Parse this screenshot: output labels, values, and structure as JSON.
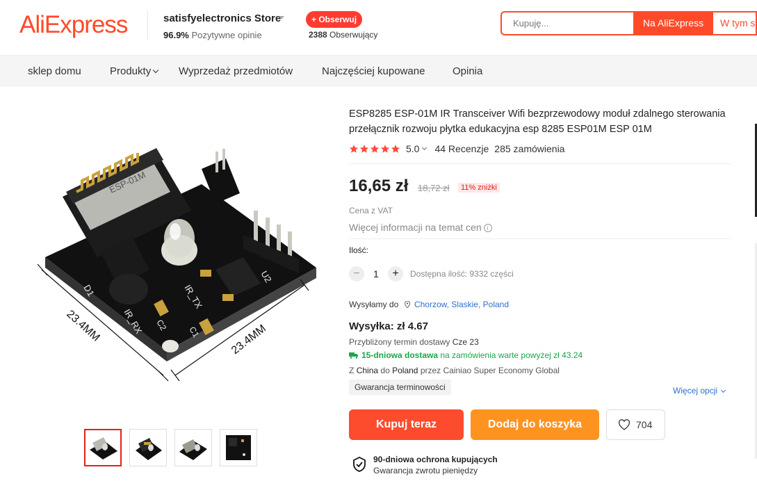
{
  "header": {
    "logo": "AliExpress",
    "store_name": "satisfyelectronics Store",
    "rating_value": "96.9%",
    "rating_label": "Pozytywne opinie",
    "follow_label": "+ Obserwuj",
    "followers_count": "2388",
    "followers_label": "Obserwujący",
    "search_placeholder": "Kupuję...",
    "search_ae_label": "Na AliExpress",
    "search_store_label": "W tym sklepie"
  },
  "nav": {
    "items": [
      {
        "label": "sklep domu"
      },
      {
        "label": "Produkty"
      },
      {
        "label": "Wyprzedaż przedmiotów"
      },
      {
        "label": "Najczęściej kupowane"
      },
      {
        "label": "Opinia"
      }
    ]
  },
  "product": {
    "title": "ESP8285 ESP-01M IR Transceiver Wifi bezprzewodowy moduł zdalnego sterowania przełącznik rozwoju płytka edukacyjna esp 8285 ESP01M ESP 01M",
    "rating": "5.0",
    "stars": 5,
    "reviews": "44 Recenzje",
    "orders": "285 zamówienia",
    "price": "16,65 zł",
    "old_price": "18,72 zł",
    "discount": "11% zniżki",
    "vat_note": "Cena z VAT",
    "more_info": "Więcej informacji na temat cen",
    "image_labels": {
      "dim_left": "23.4MM",
      "dim_right": "23.4MM",
      "d1": "D1",
      "u2": "U2",
      "ir_rx": "IR_RX",
      "ir_tx": "IR_TX",
      "c1": "C1",
      "c2": "C2",
      "chip": "ESP-01M"
    }
  },
  "quantity": {
    "label": "Ilość:",
    "minus": "−",
    "value": "1",
    "plus": "+",
    "available": "Dostępna ilość: 9332 części"
  },
  "shipping": {
    "ship_to_label": "Wysyłamy do",
    "location": "Chorzow, Slaskie, Poland",
    "cost": "Wysyłka: zł 4.67",
    "estimate_label": "Przybliżony termin dostawy",
    "estimate_date": "Cze 23",
    "fast_bold": "15-dniowa dostawa",
    "fast_rest": "na zamówienia warte powyżej zł 43.24",
    "route_from_label": "Z",
    "route_from": "China",
    "route_to_label": "do",
    "route_to": "Poland",
    "route_via": "przez Cainiao Super Economy Global",
    "guarantee_tag": "Gwarancja terminowości",
    "more_options": "Więcej opcji"
  },
  "actions": {
    "buy_now": "Kupuj teraz",
    "add_to_cart": "Dodaj do koszyka",
    "wishlist_count": "704"
  },
  "protection": {
    "title": "90-dniowa ochrona kupujących",
    "subtitle": "Gwarancja zwrotu pieniędzy"
  },
  "colors": {
    "brand": "#ff4a2a",
    "buy_now": "#fd4b2e",
    "add_to_cart": "#ff9320",
    "link": "#2e6fcb",
    "delivery_green": "#19a74b",
    "star": "#ff4b3a"
  }
}
